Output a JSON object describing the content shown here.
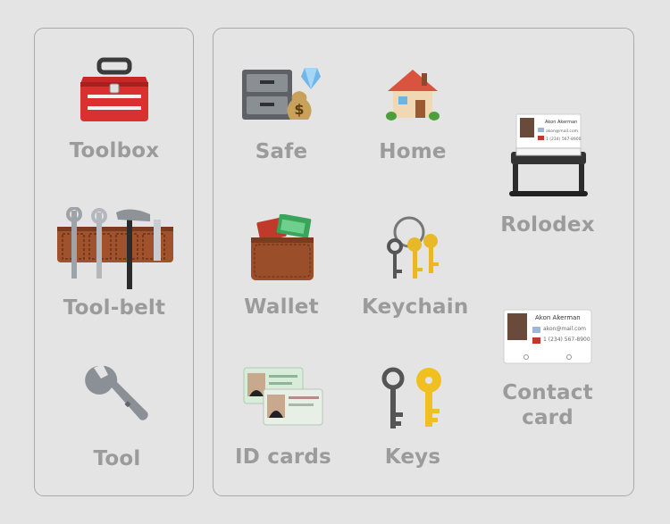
{
  "left_column": {
    "items": [
      {
        "label": "Toolbox",
        "icon": "toolbox-icon"
      },
      {
        "label": "Tool-belt",
        "icon": "tool-belt-icon"
      },
      {
        "label": "Tool",
        "icon": "wrench-icon"
      }
    ]
  },
  "right_grid": {
    "items": [
      {
        "label": "Safe",
        "icon": "safe-icon"
      },
      {
        "label": "Home",
        "icon": "home-icon"
      },
      {
        "label": "Rolodex",
        "icon": "rolodex-icon"
      },
      {
        "label": "Wallet",
        "icon": "wallet-icon"
      },
      {
        "label": "Keychain",
        "icon": "keychain-icon"
      },
      {
        "label": "Contact\ncard",
        "icon": "contact-card-icon"
      },
      {
        "label": "ID cards",
        "icon": "id-cards-icon"
      },
      {
        "label": "Keys",
        "icon": "keys-icon"
      }
    ]
  },
  "contact_card": {
    "name": "Akon Akerman",
    "email": "akon@mail.com",
    "phone": "1 (234) 567-8900"
  }
}
